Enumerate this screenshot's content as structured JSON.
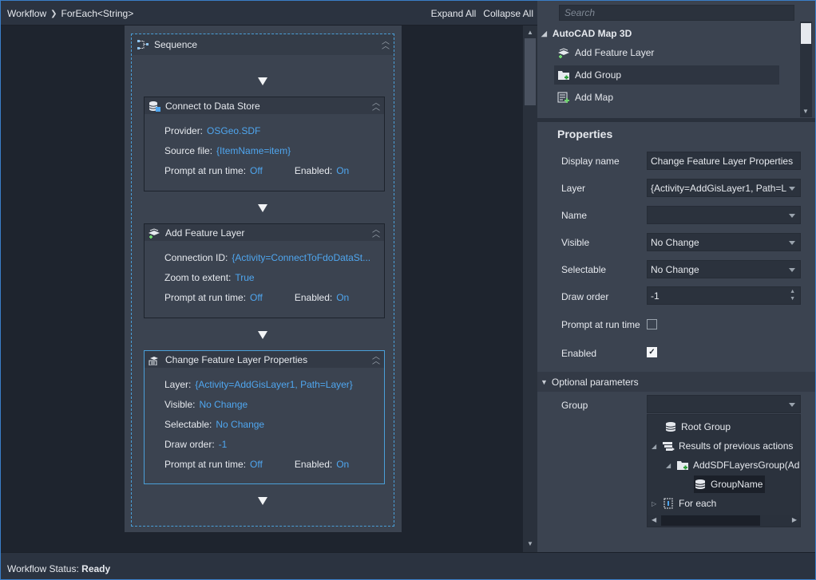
{
  "breadcrumb": {
    "root": "Workflow",
    "current": "ForEach<String>"
  },
  "workflow_actions": {
    "expand": "Expand All",
    "collapse": "Collapse All"
  },
  "sequence": {
    "title": "Sequence",
    "activities": [
      {
        "title": "Connect to Data Store",
        "icon": "database-connect-icon",
        "rows": [
          {
            "label": "Provider:",
            "value": "OSGeo.SDF"
          },
          {
            "label": "Source file:",
            "value": "{ItemName=item}"
          }
        ],
        "prompt_label": "Prompt at run time:",
        "prompt_value": "Off",
        "enabled_label": "Enabled:",
        "enabled_value": "On"
      },
      {
        "title": "Add Feature Layer",
        "icon": "add-feature-layer-icon",
        "rows": [
          {
            "label": "Connection ID:",
            "value": "{Activity=ConnectToFdoDataSt..."
          },
          {
            "label": "Zoom to extent:",
            "value": "True"
          }
        ],
        "prompt_label": "Prompt at run time:",
        "prompt_value": "Off",
        "enabled_label": "Enabled:",
        "enabled_value": "On"
      },
      {
        "title": "Change Feature Layer Properties",
        "icon": "change-layer-icon",
        "rows": [
          {
            "label": "Layer:",
            "value": "{Activity=AddGisLayer1, Path=Layer}"
          },
          {
            "label": "Visible:",
            "value": "No Change"
          },
          {
            "label": "Selectable:",
            "value": "No Change"
          },
          {
            "label": "Draw order:",
            "value": "-1"
          }
        ],
        "prompt_label": "Prompt at run time:",
        "prompt_value": "Off",
        "enabled_label": "Enabled:",
        "enabled_value": "On"
      }
    ]
  },
  "toolbox": {
    "search_placeholder": "Search",
    "group": "AutoCAD Map 3D",
    "items": [
      {
        "label": "Add Feature Layer",
        "icon": "add-feature-layer-icon"
      },
      {
        "label": "Add Group",
        "icon": "add-group-icon"
      },
      {
        "label": "Add Map",
        "icon": "add-map-icon"
      }
    ]
  },
  "properties": {
    "title": "Properties",
    "display_name": {
      "label": "Display name",
      "value": "Change Feature Layer Properties"
    },
    "layer": {
      "label": "Layer",
      "value": "{Activity=AddGisLayer1, Path=L"
    },
    "name": {
      "label": "Name",
      "value": ""
    },
    "visible": {
      "label": "Visible",
      "value": "No Change"
    },
    "selectable": {
      "label": "Selectable",
      "value": "No Change"
    },
    "draw_order": {
      "label": "Draw order",
      "value": "-1"
    },
    "prompt": {
      "label": "Prompt at run time",
      "checked": false
    },
    "enabled": {
      "label": "Enabled",
      "checked": true
    },
    "optional": {
      "title": "Optional parameters"
    },
    "group": {
      "label": "Group",
      "value": ""
    }
  },
  "group_tree": {
    "items": [
      {
        "label": "Root Group",
        "icon": "database-icon"
      },
      {
        "label": "Results of previous actions",
        "icon": "results-icon"
      },
      {
        "label": "AddSDFLayersGroup(Ad",
        "icon": "add-group-icon"
      },
      {
        "label": "GroupName",
        "icon": "database-icon"
      },
      {
        "label": "For each",
        "icon": "foreach-icon"
      }
    ]
  },
  "status": {
    "label": "Workflow Status:",
    "value": "Ready"
  },
  "colors": {
    "accent": "#4fa6ef",
    "panel": "#3b4350",
    "canvas": "#1e242e",
    "selection": "#4a9fd8"
  }
}
